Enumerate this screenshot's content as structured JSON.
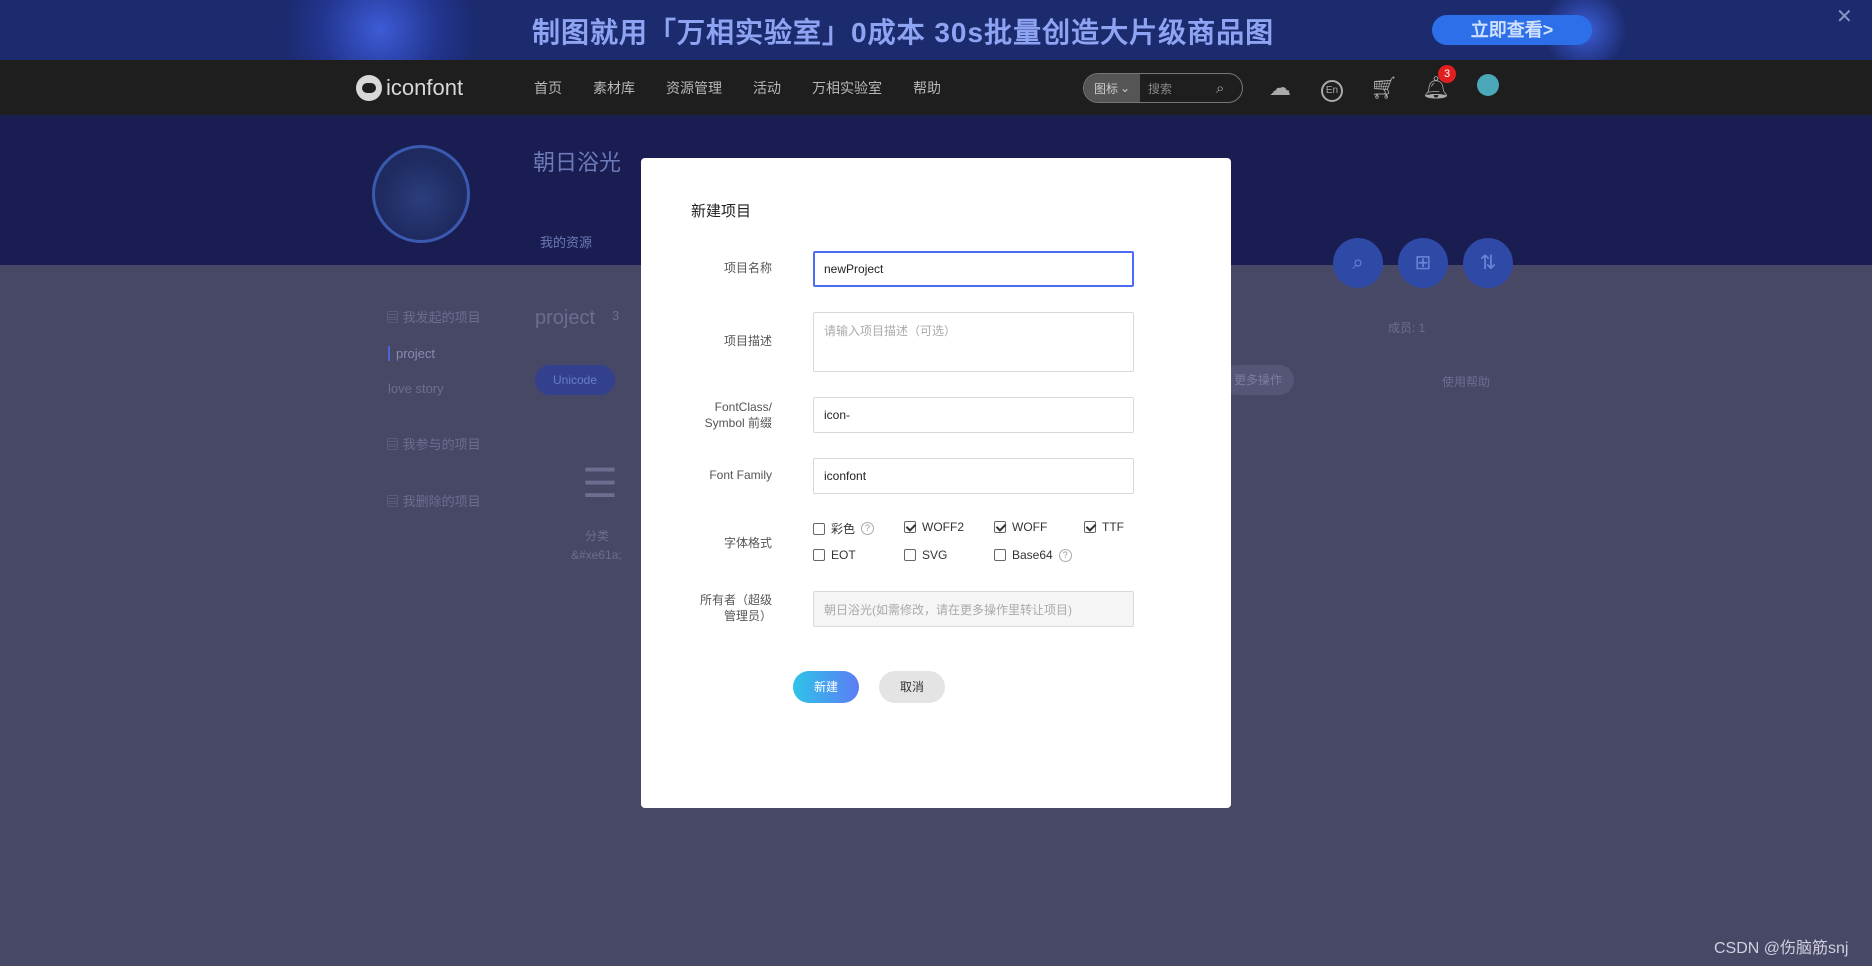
{
  "banner": {
    "text": "制图就用「万相实验室」0成本 30s批量创造大片级商品图",
    "cta": "立即查看>",
    "close": "✕"
  },
  "nav": {
    "logo": "iconfont",
    "links": [
      "首页",
      "素材库",
      "资源管理",
      "活动",
      "万相实验室",
      "帮助"
    ],
    "search_type": "图标",
    "search_placeholder": "搜索",
    "lang": "En",
    "notification_count": "3"
  },
  "profile": {
    "name": "朝日浴光",
    "tab": "我的资源"
  },
  "sidebar": {
    "started": "我发起的项目",
    "project_active": "project",
    "project_other": "love story",
    "joined": "我参与的项目",
    "deleted": "我删除的项目"
  },
  "main": {
    "title": "project",
    "count": "3",
    "unicode_tab": "Unicode",
    "gray_btn": "更多操作",
    "help": "使用帮助",
    "share": "成员: 1",
    "icon_name": "分类",
    "icon_code": "&#xe61a;"
  },
  "dialog": {
    "title": "新建项目",
    "name_label": "项目名称",
    "name_value": "newProject",
    "desc_label": "项目描述",
    "desc_placeholder": "请输入项目描述（可选）",
    "prefix_label_1": "FontClass/",
    "prefix_label_2": "Symbol 前缀",
    "prefix_value": "icon-",
    "family_label": "Font Family",
    "family_value": "iconfont",
    "format_label": "字体格式",
    "formats": [
      {
        "label": "彩色",
        "checked": false
      },
      {
        "label": "WOFF2",
        "checked": true
      },
      {
        "label": "WOFF",
        "checked": true
      },
      {
        "label": "TTF",
        "checked": true
      },
      {
        "label": "EOT",
        "checked": false
      },
      {
        "label": "SVG",
        "checked": false
      },
      {
        "label": "Base64",
        "checked": false
      }
    ],
    "owner_label_1": "所有者（超级",
    "owner_label_2": "管理员）",
    "owner_value": "朝日浴光(如需修改，请在更多操作里转让项目)",
    "create_btn": "新建",
    "cancel_btn": "取消"
  },
  "watermark": "CSDN @伤脑筋snj"
}
